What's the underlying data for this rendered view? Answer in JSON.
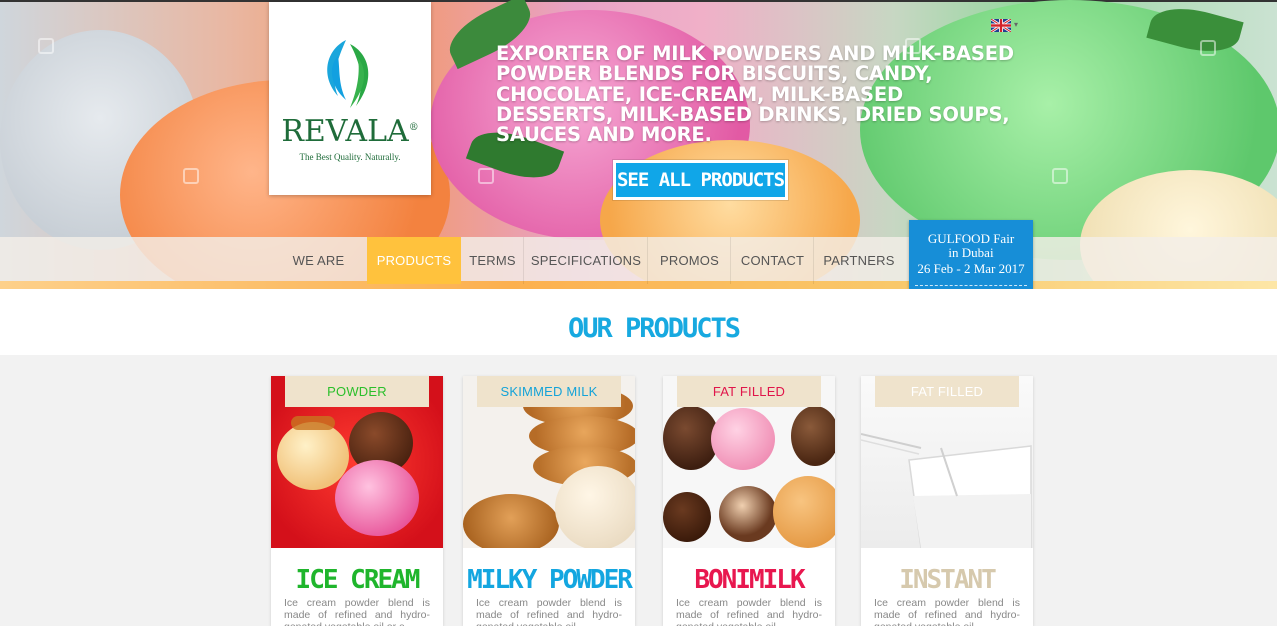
{
  "brand": {
    "name": "REVALA",
    "registered": "®",
    "tagline": "The Best Quality. Naturally."
  },
  "language": {
    "flag": "uk-flag-icon",
    "caret": "▾"
  },
  "hero": {
    "headline": "EXPORTER OF MILK POWDERS AND MILK-BASED POWDER BLENDS FOR BISCUITS, CANDY, CHOCOLATE, ICE-CREAM, MILK-BASED DESSERTS, MILK-BASED DRINKS, DRIED SOUPS, SAUCES AND MORE.",
    "cta_label": "SEE ALL PRODUCTS"
  },
  "nav": {
    "items": [
      {
        "label": "WE ARE"
      },
      {
        "label": "PRODUCTS",
        "active": true
      },
      {
        "label": "TERMS"
      },
      {
        "label": "SPECIFICATIONS"
      },
      {
        "label": "PROMOS"
      },
      {
        "label": "CONTACT"
      },
      {
        "label": "PARTNERS"
      }
    ]
  },
  "event": {
    "line1": "GULFOOD Fair",
    "line2": "in Dubai",
    "line3": "26 Feb - 2 Mar 2017"
  },
  "products_section": {
    "title": "OUR PRODUCTS"
  },
  "products": [
    {
      "tag": "POWDER",
      "name": "ICE CREAM",
      "desc": "Ice cream powder blend is made of refined and hydro-genated vegetable oil or a",
      "tag_color": "#2bbf2b",
      "name_color": "#1fb52c",
      "image": "ice-cream-scoops"
    },
    {
      "tag": "SKIMMED MILK",
      "name": "MILKY POWDER",
      "desc": "Ice cream powder blend is made of refined and hydro-genated vegetable oil",
      "tag_color": "#14a3d8",
      "name_color": "#13a6e0",
      "image": "cookies-and-ice-cream"
    },
    {
      "tag": "FAT FILLED",
      "name": "BONIMILK",
      "desc": "Ice cream powder blend is made of refined and hydro-genated vegetable oil",
      "tag_color": "#e0154a",
      "name_color": "#e8174f",
      "image": "chocolate-truffles"
    },
    {
      "tag": "FAT FILLED",
      "name": "INSTANT",
      "desc": "Ice cream powder blend is made of refined and hydro-genated vegetable oil",
      "tag_color": "#ffffff",
      "name_color": "#d6c9ad",
      "image": "glass-of-milk"
    }
  ],
  "colors": {
    "accent_blue": "#10a6e8",
    "nav_active": "#ffc23d",
    "brand_green": "#1f6c3a"
  }
}
